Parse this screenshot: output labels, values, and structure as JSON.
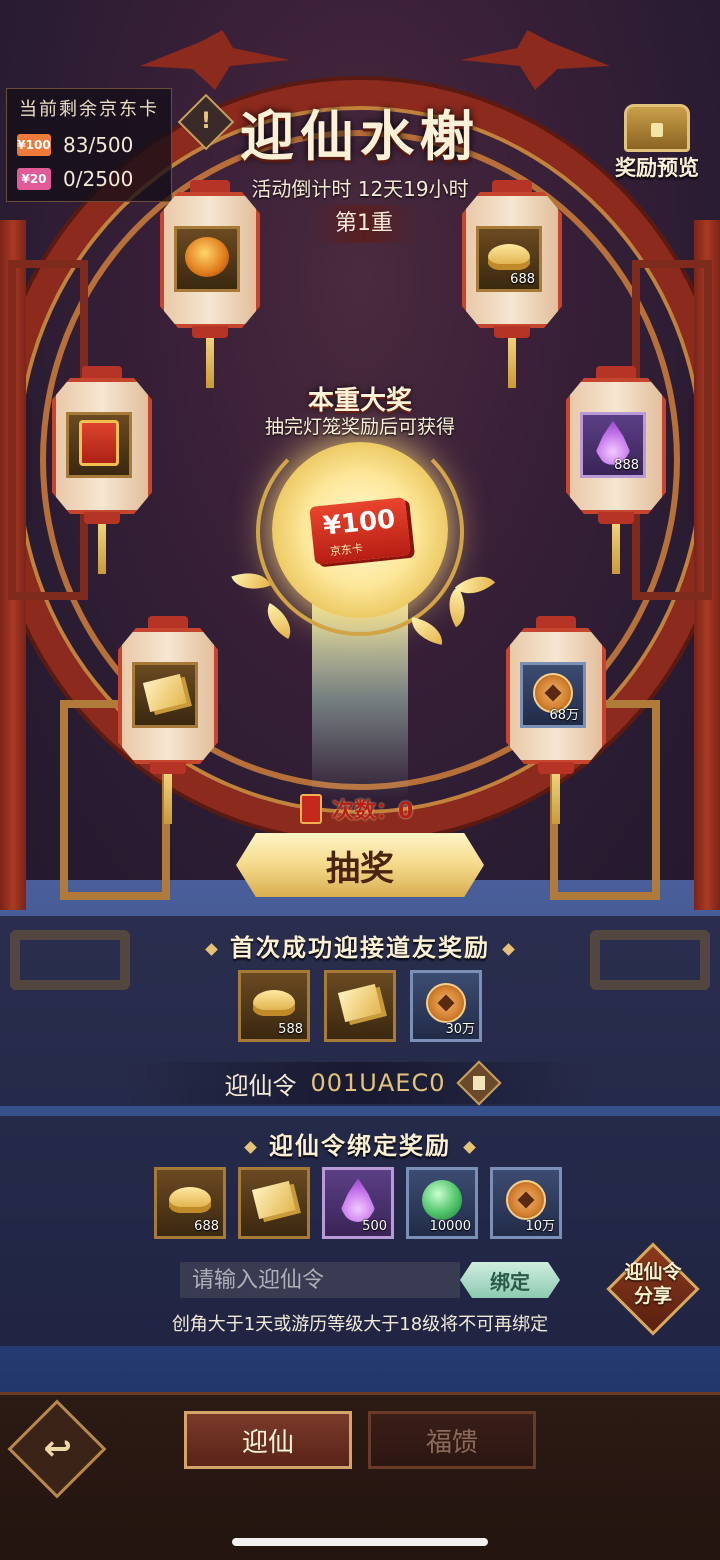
{
  "card_counter": {
    "title": "当前剩余京东卡",
    "rows": [
      {
        "card_label": "¥100",
        "card_color": "#f07a3a",
        "value": "83/500"
      },
      {
        "card_label": "¥20",
        "card_color": "#e35a9a",
        "value": "0/2500"
      }
    ]
  },
  "header": {
    "title": "迎仙水榭",
    "countdown": "活动倒计时 12天19小时",
    "tier": "第1重",
    "info_icon": "exclamation-icon",
    "reward_preview_label": "奖励预览"
  },
  "lanterns": [
    {
      "icon": "peach-icon",
      "qty": "",
      "color": "gold"
    },
    {
      "icon": "gold-ingot-icon",
      "qty": "688",
      "color": "gold"
    },
    {
      "icon": "red-envelope-icon",
      "qty": "",
      "color": "gold"
    },
    {
      "icon": "purple-flame-icon",
      "qty": "888",
      "color": "purple"
    },
    {
      "icon": "ticket-icon",
      "qty": "",
      "color": "gold"
    },
    {
      "icon": "copper-coin-icon",
      "qty": "68万",
      "color": "blue"
    }
  ],
  "grand_prize": {
    "title": "本重大奖",
    "subtitle": "抽完灯笼奖励后可获得",
    "card_amount": "¥100",
    "card_label": "京东卡"
  },
  "draw": {
    "count_label": "次数：0",
    "button_label": "抽奖"
  },
  "first_success": {
    "title": "首次成功迎接道友奖励",
    "items": [
      {
        "icon": "gold-ingot-icon",
        "qty": "588",
        "color": "gold"
      },
      {
        "icon": "ticket-icon",
        "qty": "",
        "color": "gold"
      },
      {
        "icon": "copper-coin-icon",
        "qty": "30万",
        "color": "blue"
      }
    ],
    "code_label": "迎仙令",
    "code_value": "001UAEC0"
  },
  "bind": {
    "title": "迎仙令绑定奖励",
    "items": [
      {
        "icon": "gold-ingot-icon",
        "qty": "688",
        "color": "gold"
      },
      {
        "icon": "ticket-icon",
        "qty": "",
        "color": "gold"
      },
      {
        "icon": "purple-flame-icon",
        "qty": "500",
        "color": "purple"
      },
      {
        "icon": "green-orb-icon",
        "qty": "10000",
        "color": "blue"
      },
      {
        "icon": "copper-coin-icon",
        "qty": "10万",
        "color": "blue"
      }
    ],
    "input_placeholder": "请输入迎仙令",
    "bind_button": "绑定",
    "rule_text": "创角大于1天或游历等级大于18级将不可再绑定",
    "share_line1": "迎仙令",
    "share_line2": "分享"
  },
  "bottom_nav": {
    "back_icon": "back-arrow-icon",
    "tabs": [
      {
        "label": "迎仙",
        "active": true
      },
      {
        "label": "福馈",
        "active": false
      }
    ]
  }
}
